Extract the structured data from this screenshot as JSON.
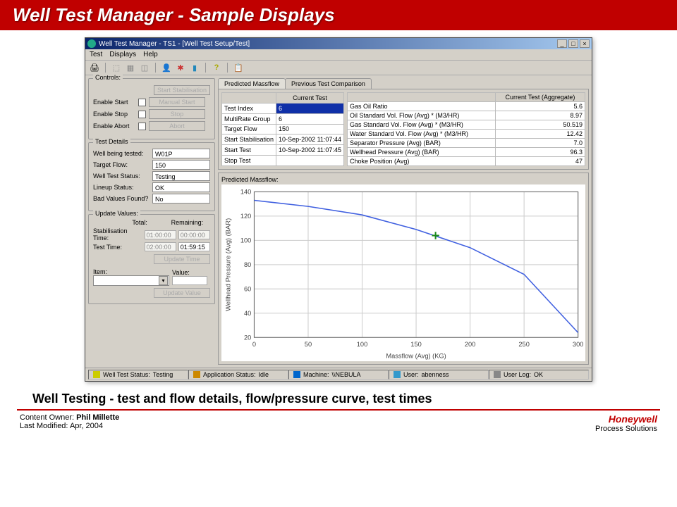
{
  "slide": {
    "title": "Well Test Manager - Sample Displays",
    "caption": "Well Testing - test and flow details, flow/pressure curve, test times"
  },
  "window": {
    "title": "Well Test Manager - TS1 - [Well Test Setup/Test]",
    "menus": [
      "Test",
      "Displays",
      "Help"
    ]
  },
  "controls": {
    "legend": "Controls:",
    "buttons": {
      "start_stabilisation": "Start Stabilisation",
      "manual_start": "Manual Start",
      "stop": "Stop",
      "abort": "Abort"
    },
    "labels": {
      "enable_start": "Enable Start",
      "enable_stop": "Enable Stop",
      "enable_abort": "Enable Abort"
    }
  },
  "test_details": {
    "legend": "Test Details",
    "rows": [
      {
        "label": "Well being tested:",
        "value": "W01P"
      },
      {
        "label": "Target Flow:",
        "value": "150"
      },
      {
        "label": "Well Test Status:",
        "value": "Testing"
      },
      {
        "label": "Lineup Status:",
        "value": "OK"
      },
      {
        "label": "Bad Values Found?",
        "value": "No"
      }
    ]
  },
  "update_values": {
    "legend": "Update Values:",
    "headers": {
      "total": "Total:",
      "remaining": "Remaining:"
    },
    "rows": [
      {
        "label": "Stabilisation Time:",
        "total": "01:00:00",
        "remaining": "00:00:00"
      },
      {
        "label": "Test Time:",
        "total": "02:00:00",
        "remaining": "01:59:15"
      }
    ],
    "update_time_btn": "Update Time",
    "item_label": "Item:",
    "value_label": "Value:",
    "update_value_btn": "Update Value"
  },
  "tabs": {
    "predicted": "Predicted Massflow",
    "previous": "Previous Test Comparison"
  },
  "current_test": {
    "header": "Current Test",
    "rows": [
      {
        "label": "Test Index",
        "value": "6",
        "hl": true
      },
      {
        "label": "MultiRate Group",
        "value": "6"
      },
      {
        "label": "Target Flow",
        "value": "150"
      },
      {
        "label": "Start Stabilisation",
        "value": "10-Sep-2002 11:07:44"
      },
      {
        "label": "Start Test",
        "value": "10-Sep-2002 11:07:45"
      },
      {
        "label": "Stop Test",
        "value": ""
      }
    ]
  },
  "aggregate": {
    "header": "Current Test (Aggregate)",
    "rows": [
      {
        "label": "Gas Oil Ratio",
        "value": "5.6"
      },
      {
        "label": "Oil Standard Vol. Flow (Avg) * (M3/HR)",
        "value": "8.97"
      },
      {
        "label": "Gas Standard Vol. Flow (Avg) * (M3/HR)",
        "value": "50.519"
      },
      {
        "label": "Water Standard Vol. Flow (Avg) * (M3/HR)",
        "value": "12.42"
      },
      {
        "label": "Separator Pressure (Avg) (BAR)",
        "value": "7.0"
      },
      {
        "label": "Wellhead Pressure (Avg) (BAR)",
        "value": "96.3"
      },
      {
        "label": "Choke Position (Avg)",
        "value": "47"
      }
    ]
  },
  "chart_panel_label": "Predicted Massflow:",
  "chart_data": {
    "type": "line",
    "title": "",
    "xlabel": "Massflow (Avg) (KG)",
    "ylabel": "Wellhead Pressure (Avg) (BAR)",
    "xlim": [
      0,
      300
    ],
    "ylim": [
      20,
      140
    ],
    "xticks": [
      0,
      50,
      100,
      150,
      200,
      250,
      300
    ],
    "yticks": [
      20,
      40,
      60,
      80,
      100,
      120,
      140
    ],
    "series": [
      {
        "name": "Predicted",
        "color": "#4060e0",
        "x": [
          0,
          50,
          100,
          150,
          200,
          250,
          300
        ],
        "y": [
          133,
          128,
          121,
          109,
          94,
          72,
          24
        ]
      }
    ],
    "marker": {
      "x": 168,
      "y": 104,
      "symbol": "+",
      "color": "#1a8a1a"
    }
  },
  "status": {
    "well_test": {
      "label": "Well Test Status:",
      "value": "Testing"
    },
    "app": {
      "label": "Application Status:",
      "value": "Idle"
    },
    "machine": {
      "label": "Machine:",
      "value": "\\\\NEBULA"
    },
    "user": {
      "label": "User:",
      "value": "abenness"
    },
    "log": {
      "label": "User Log:",
      "value": "OK"
    }
  },
  "footer": {
    "owner_label": "Content Owner:",
    "owner": "Phil Millette",
    "modified_label": "Last Modified:",
    "modified": "Apr, 2004",
    "brand": "Honeywell",
    "division": "Process Solutions"
  }
}
